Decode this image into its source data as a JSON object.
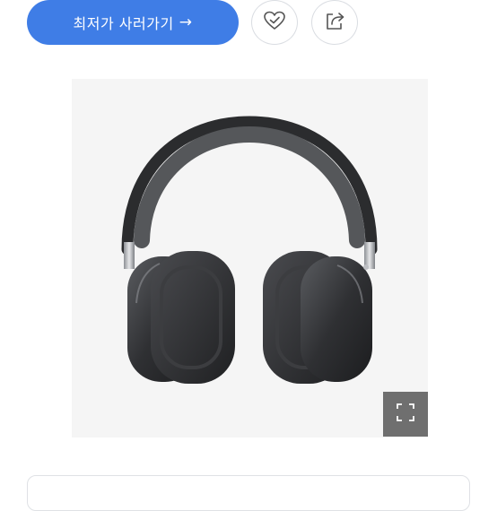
{
  "buy_button": {
    "label": "최저가 사러가기",
    "arrow": "→"
  },
  "wishlist_button": {
    "icon": "heart-check-icon"
  },
  "share_button": {
    "icon": "share-icon"
  },
  "product": {
    "image": "headphones-image"
  },
  "zoom_button": {
    "icon": "expand-icon"
  },
  "colors": {
    "accent": "#3f7de6",
    "zoom_bg": "#6f6f6f",
    "image_bg": "#f5f5f5"
  }
}
